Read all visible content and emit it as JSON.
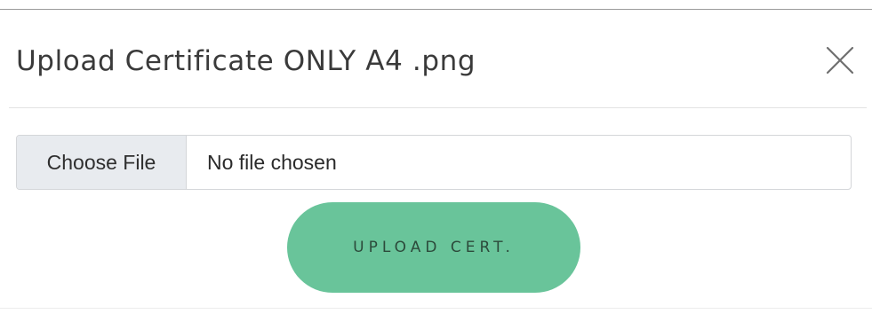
{
  "modal": {
    "title": "Upload Certificate ONLY A4 .png",
    "close_icon": "close-icon"
  },
  "file_input": {
    "button_label": "Choose File",
    "status_text": "No file chosen"
  },
  "actions": {
    "upload_label": "UPLOAD CERT."
  },
  "colors": {
    "upload_button": "#69c49a",
    "choose_file_bg": "#e8ebef",
    "title_text": "#3a3a3a"
  }
}
